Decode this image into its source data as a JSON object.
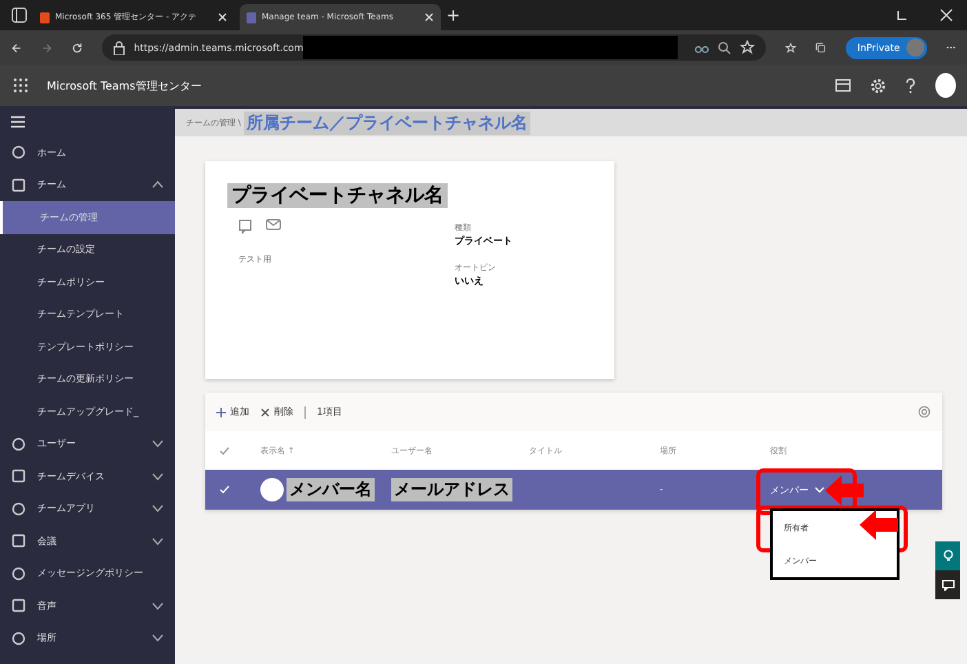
{
  "browser": {
    "tabs": [
      {
        "title": "Microsoft 365 管理センター - アクテ",
        "selected": false
      },
      {
        "title": "Manage team - Microsoft Teams",
        "selected": true
      }
    ],
    "new_tab": "+",
    "url": "https://admin.teams.microsoft.com",
    "inprivate": "InPrivate"
  },
  "app_header": {
    "title": "Microsoft Teams管理センター"
  },
  "sidebar": {
    "items": [
      {
        "label": "ホーム",
        "selected": false
      },
      {
        "label": "チーム",
        "selected": false,
        "expanded": true,
        "children": [
          {
            "label": "チームの管理",
            "selected": true
          },
          {
            "label": "チームの設定",
            "selected": false
          },
          {
            "label": "チームポリシー",
            "selected": false
          },
          {
            "label": "チームテンプレート",
            "selected": false
          },
          {
            "label": "テンプレートポリシー",
            "selected": false
          },
          {
            "label": "チームの更新ポリシー",
            "selected": false
          },
          {
            "label": "チームアップグレード_",
            "selected": false
          }
        ]
      },
      {
        "label": "ユーザー",
        "selected": false,
        "expanded": false
      },
      {
        "label": "チームデバイス",
        "selected": false,
        "expanded": false
      },
      {
        "label": "チームアプリ",
        "selected": false,
        "expanded": false
      },
      {
        "label": "会議",
        "selected": false,
        "expanded": false
      },
      {
        "label": "メッセージングポリシー",
        "selected": false
      },
      {
        "label": "音声",
        "selected": false,
        "expanded": false
      },
      {
        "label": "場所",
        "selected": false,
        "expanded": false
      }
    ]
  },
  "breadcrumb": {
    "parent": "チームの管理 \\",
    "current": "所属チーム／プライベートチャネル名"
  },
  "channel_card": {
    "title": "プライベートチャネル名",
    "description": "テスト用",
    "fields": [
      {
        "label": "種類",
        "value": "プライベート"
      },
      {
        "label": "オートピン",
        "value": "いいえ"
      }
    ]
  },
  "members": {
    "toolbar": {
      "add": "追加",
      "remove": "削除",
      "count": "1項目"
    },
    "columns": [
      "表示名 ↑",
      "ユーザー名",
      "タイトル",
      "場所",
      "役割"
    ],
    "rows": [
      {
        "selected": true,
        "name": "メンバー名",
        "email": "メールアドレス",
        "title": "",
        "location": "-",
        "role": "メンバー"
      }
    ],
    "role_menu": [
      {
        "label": "所有者"
      },
      {
        "label": "メンバー"
      }
    ]
  }
}
